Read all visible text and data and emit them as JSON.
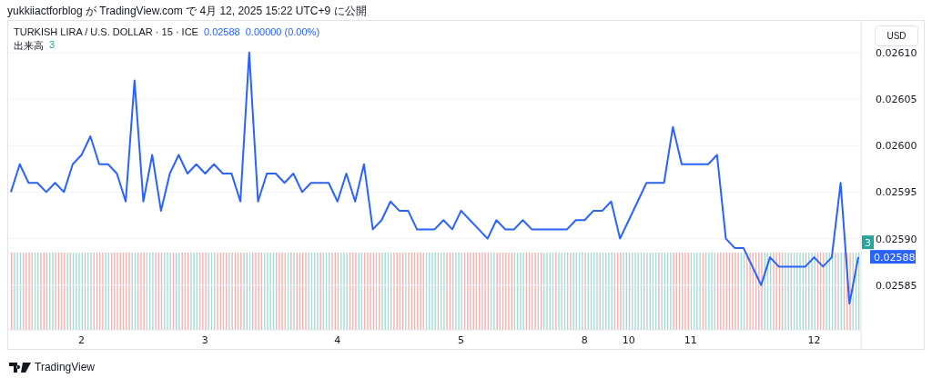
{
  "caption": "yukkiiactforblog が TradingView.com で 4月 12, 2025 15:22 UTC+9 に公開",
  "legend": {
    "symbol": "TURKISH LIRA / U.S. DOLLAR · 15 · ICE",
    "price": "0.02588",
    "change": "0.00000 (0.00%)",
    "volume_label": "出来高",
    "volume_value": "3"
  },
  "currency_button": "USD",
  "axis_badges": [
    {
      "kind": "volume",
      "text": "3"
    },
    {
      "kind": "last",
      "text": "0.02588"
    }
  ],
  "chart_data": {
    "type": "line",
    "categories": [
      null,
      null,
      null,
      null,
      null,
      null,
      null,
      null,
      "2",
      null,
      null,
      null,
      null,
      null,
      null,
      null,
      null,
      null,
      null,
      null,
      null,
      null,
      "3",
      null,
      null,
      null,
      null,
      null,
      null,
      null,
      null,
      null,
      null,
      null,
      null,
      null,
      null,
      "4",
      null,
      null,
      null,
      null,
      null,
      null,
      null,
      null,
      null,
      null,
      null,
      null,
      null,
      "5",
      null,
      null,
      null,
      null,
      null,
      null,
      null,
      null,
      null,
      null,
      null,
      null,
      null,
      "8",
      null,
      null,
      null,
      null,
      "10",
      null,
      null,
      null,
      null,
      null,
      null,
      "11",
      null,
      null,
      null,
      null,
      null,
      null,
      null,
      null,
      null,
      null,
      null,
      null,
      null,
      "12",
      null,
      null,
      null,
      null,
      null
    ],
    "series": [
      {
        "color": "#2962ff",
        "values": [
          0.02595,
          0.02598,
          0.02596,
          0.02596,
          0.02595,
          0.02596,
          0.02595,
          0.02598,
          0.02599,
          0.02601,
          0.02598,
          0.02598,
          0.02597,
          0.02594,
          0.02607,
          0.02594,
          0.02599,
          0.02593,
          0.02597,
          0.02599,
          0.02597,
          0.02598,
          0.02597,
          0.02598,
          0.02597,
          0.02597,
          0.02594,
          0.0261,
          0.02594,
          0.02597,
          0.02597,
          0.02596,
          0.02597,
          0.02595,
          0.02596,
          0.02596,
          0.02596,
          0.02594,
          0.02597,
          0.02594,
          0.02598,
          0.02591,
          0.02592,
          0.02594,
          0.02593,
          0.02593,
          0.02591,
          0.02591,
          0.02591,
          0.02592,
          0.02591,
          0.02593,
          0.02592,
          0.02591,
          0.0259,
          0.02592,
          0.02591,
          0.02591,
          0.02592,
          0.02591,
          0.02591,
          0.02591,
          0.02591,
          0.02591,
          0.02592,
          0.02592,
          0.02593,
          0.02593,
          0.02594,
          0.0259,
          0.02592,
          0.02594,
          0.02596,
          0.02596,
          0.02596,
          0.02602,
          0.02598,
          0.02598,
          0.02598,
          0.02598,
          0.02599,
          0.0259,
          0.02589,
          0.02589,
          0.02587,
          0.02585,
          0.02588,
          0.02587,
          0.02587,
          0.02587,
          0.02587,
          0.02588,
          0.02587,
          0.02588,
          0.02596,
          0.02583,
          0.02588
        ]
      }
    ],
    "grid": true,
    "ylim": [
      0.025802,
      0.026134
    ],
    "yticks": [
      {
        "value": 0.02585,
        "label": "0.02585"
      },
      {
        "value": 0.0259,
        "label": "0.02590"
      },
      {
        "value": 0.02595,
        "label": "0.02595"
      },
      {
        "value": 0.026,
        "label": "0.02600"
      },
      {
        "value": 0.02605,
        "label": "0.02605"
      },
      {
        "value": 0.0261,
        "label": "0.02610"
      }
    ]
  },
  "footer": {
    "brand": "TradingView"
  }
}
